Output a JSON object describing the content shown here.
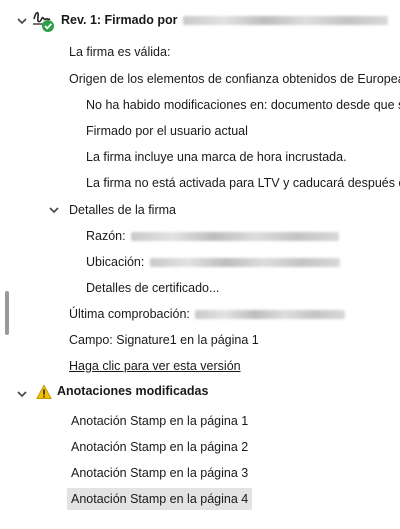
{
  "revision": {
    "label": "Rev. 1: Firmado por",
    "items": {
      "valid": "La firma es válida:",
      "origin": "Origen de los elementos de confianza obtenidos de Europea",
      "no_changes": "No ha habido modificaciones en: documento desde que s",
      "signed_by_user": "Firmado por el usuario actual",
      "timestamp": "La firma incluye una marca de hora incrustada.",
      "ltv": "La firma no está activada para LTV y caducará después d"
    },
    "details": {
      "label": "Detalles de la firma",
      "reason": "Razón:",
      "location": "Ubicación:",
      "certificate": "Detalles de certificado..."
    },
    "last_check": "Última comprobación:",
    "field": "Campo: Signature1 en la página 1",
    "view_version": "Haga clic para ver esta versión"
  },
  "annotations": {
    "label": "Anotaciones modificadas",
    "items": [
      "Anotación Stamp en la página 1",
      "Anotación Stamp en la página 2",
      "Anotación Stamp en la página 3",
      "Anotación Stamp en la página 4"
    ]
  },
  "colors": {
    "check_green": "#2ea043",
    "warning_yellow": "#f2c200",
    "selection": "#e3e3e3"
  },
  "icons": [
    "signature-icon",
    "valid-check-icon",
    "warning-icon",
    "chevron-down-icon"
  ]
}
